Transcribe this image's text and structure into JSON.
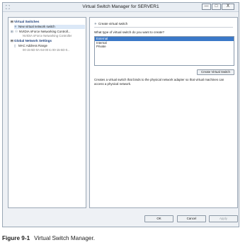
{
  "window": {
    "title": "Virtual Switch Manager for SERVER1",
    "controls": {
      "minimize": "—",
      "maximize": "□",
      "close": "X"
    }
  },
  "sidebar": {
    "virtual_switches_header": "Virtual Switches",
    "items": [
      {
        "label": "New virtual network switch",
        "icon": "new-switch-icon"
      },
      {
        "label": "NVIDIA nForce Networking Controll...",
        "sub": "NVIDIA nForce Networking Controller",
        "icon": "network-switch-icon"
      }
    ],
    "global_header": "Global Network Settings",
    "global_items": [
      {
        "label": "MAC Address Range",
        "sub": "00-15-5D-0A-64-00 to 00-15-5D-0...",
        "icon": "mac-address-icon"
      }
    ]
  },
  "main": {
    "header": "Create virtual switch",
    "question": "What type of virtual switch do you want to create?",
    "switch_types": [
      {
        "label": "External",
        "selected": true
      },
      {
        "label": "Internal",
        "selected": false
      },
      {
        "label": "Private",
        "selected": false
      }
    ],
    "create_button": "Create Virtual Switch",
    "description": "Creates a virtual switch that binds to the physical network adapter so that virtual machines can access a physical network."
  },
  "footer": {
    "ok": "OK",
    "cancel": "Cancel",
    "apply": "Apply"
  },
  "caption": {
    "figure": "Figure 9-1",
    "text": "Virtual Switch Manager."
  }
}
